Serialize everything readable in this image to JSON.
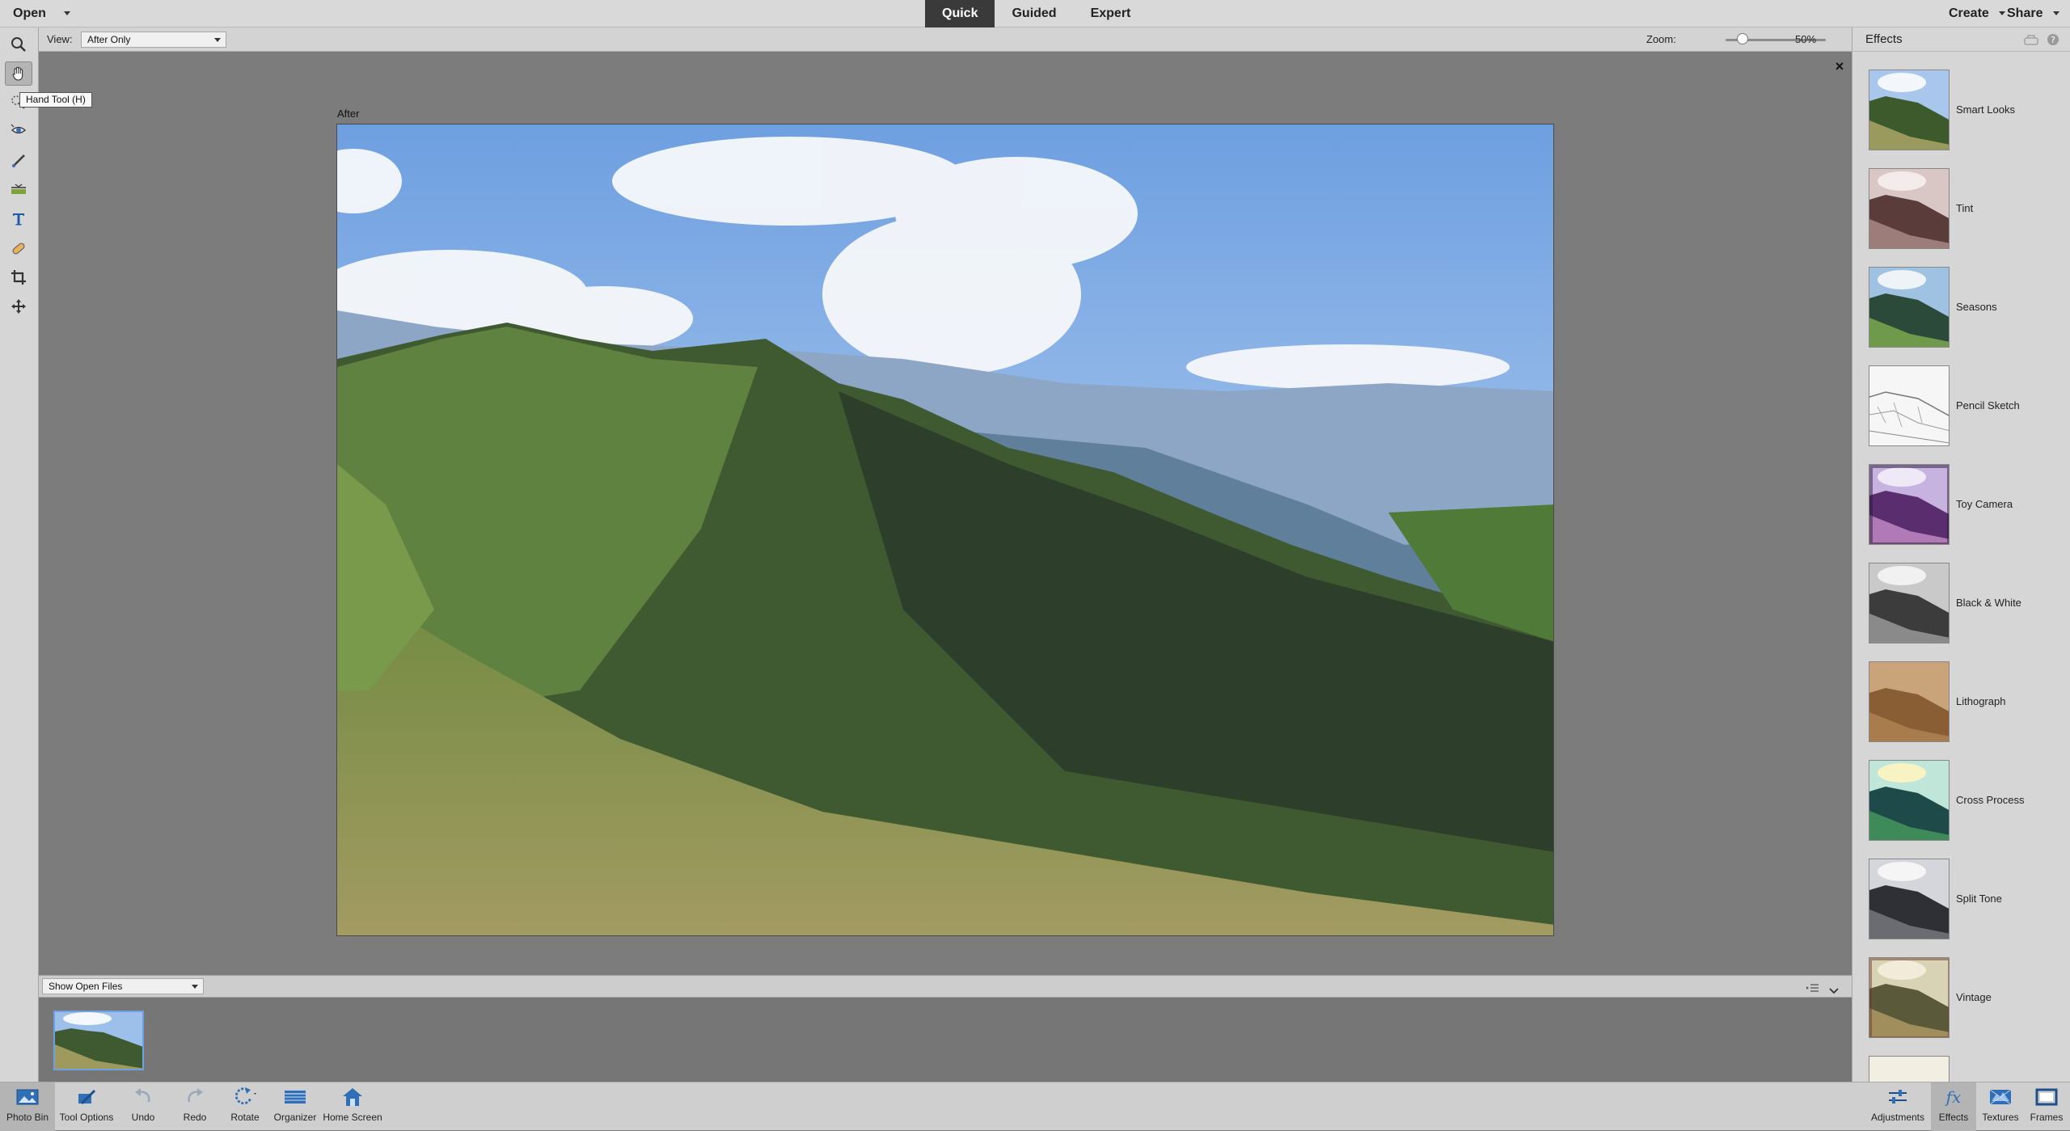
{
  "topbar": {
    "open_label": "Open",
    "modes": [
      {
        "label": "Quick",
        "active": true
      },
      {
        "label": "Guided",
        "active": false
      },
      {
        "label": "Expert",
        "active": false
      }
    ],
    "create_label": "Create",
    "share_label": "Share"
  },
  "options": {
    "view_label": "View:",
    "view_value": "After Only",
    "zoom_label": "Zoom:",
    "zoom_value": "50%",
    "zoom_level": 0.17
  },
  "tools": {
    "active": "hand-tool",
    "tooltip": "Hand Tool (H)",
    "items": [
      "zoom-tool",
      "hand-tool",
      "quick-selection-tool",
      "red-eye-tool",
      "whiten-teeth-tool",
      "straighten-tool",
      "type-tool",
      "spot-healing-brush-tool",
      "crop-tool",
      "move-tool"
    ]
  },
  "canvas": {
    "after_label": "After",
    "close_glyph": "×"
  },
  "photo_bin": {
    "show_label": "Show Open Files"
  },
  "effects_panel": {
    "title": "Effects",
    "items": [
      {
        "label": "Smart Looks"
      },
      {
        "label": "Tint"
      },
      {
        "label": "Seasons"
      },
      {
        "label": "Pencil Sketch"
      },
      {
        "label": "Toy Camera"
      },
      {
        "label": "Black & White"
      },
      {
        "label": "Lithograph"
      },
      {
        "label": "Cross Process"
      },
      {
        "label": "Split Tone"
      },
      {
        "label": "Vintage"
      }
    ]
  },
  "bottombar": {
    "left": [
      {
        "label": "Photo Bin",
        "icon": "photo-bin-icon"
      },
      {
        "label": "Tool Options",
        "icon": "tool-options-icon"
      },
      {
        "label": "Undo",
        "icon": "undo-icon"
      },
      {
        "label": "Redo",
        "icon": "redo-icon"
      },
      {
        "label": "Rotate",
        "icon": "rotate-icon"
      },
      {
        "label": "Organizer",
        "icon": "organizer-icon"
      },
      {
        "label": "Home Screen",
        "icon": "home-icon"
      }
    ],
    "right": [
      {
        "label": "Adjustments",
        "icon": "adjustments-icon"
      },
      {
        "label": "Effects",
        "icon": "effects-fx-icon"
      },
      {
        "label": "Textures",
        "icon": "textures-icon"
      },
      {
        "label": "Frames",
        "icon": "frames-icon"
      }
    ]
  },
  "colors": {
    "accent_blue": "#6fa0df",
    "active_tab_bg": "#3a3a3a",
    "workspace_gray": "#7c7c7c"
  }
}
